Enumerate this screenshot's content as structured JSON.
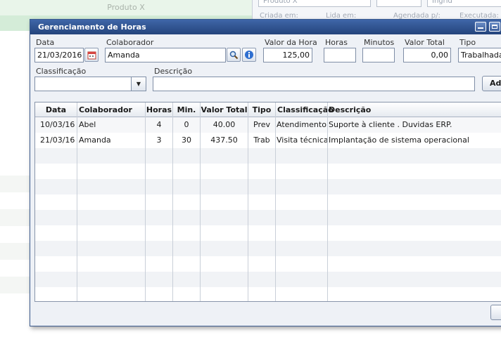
{
  "background": {
    "product_label": "Produto X",
    "right_fields": [
      "Produto X",
      "",
      "Ingrid"
    ],
    "right_labels": [
      "Criada em:",
      "Lida em:",
      "Agendada p/:",
      "Executada:"
    ]
  },
  "dialog": {
    "title": "Gerenciamento de Horas",
    "form": {
      "data_label": "Data",
      "data_value": "21/03/2016",
      "colaborador_label": "Colaborador",
      "colaborador_value": "Amanda",
      "valor_hora_label": "Valor da Hora",
      "valor_hora_value": "125,00",
      "horas_label": "Horas",
      "horas_value": "",
      "minutos_label": "Minutos",
      "minutos_value": "",
      "valor_total_label": "Valor Total",
      "valor_total_value": "0,00",
      "tipo_label": "Tipo",
      "tipo_value": "Trabalhada",
      "classificacao_label": "Classificação",
      "classificacao_value": "",
      "descricao_label": "Descrição",
      "descricao_value": "",
      "add_button_label": "Adicionar"
    },
    "table": {
      "headers": {
        "data": "Data",
        "colaborador": "Colaborador",
        "horas": "Horas",
        "min": "Min.",
        "valor_total": "Valor Total",
        "tipo": "Tipo",
        "classificacao": "Classificação",
        "descricao": "Descrição"
      },
      "rows": [
        {
          "data": "10/03/16",
          "colaborador": "Abel",
          "horas": "4",
          "min": "0",
          "valor_total": "40.00",
          "tipo": "Prev",
          "classificacao": "Atendimento",
          "descricao": "Suporte à cliente . Duvidas ERP."
        },
        {
          "data": "21/03/16",
          "colaborador": "Amanda",
          "horas": "3",
          "min": "30",
          "valor_total": "437.50",
          "tipo": "Trab",
          "classificacao": "Visita técnica",
          "descricao": "Implantação de sistema operacional"
        }
      ]
    }
  }
}
